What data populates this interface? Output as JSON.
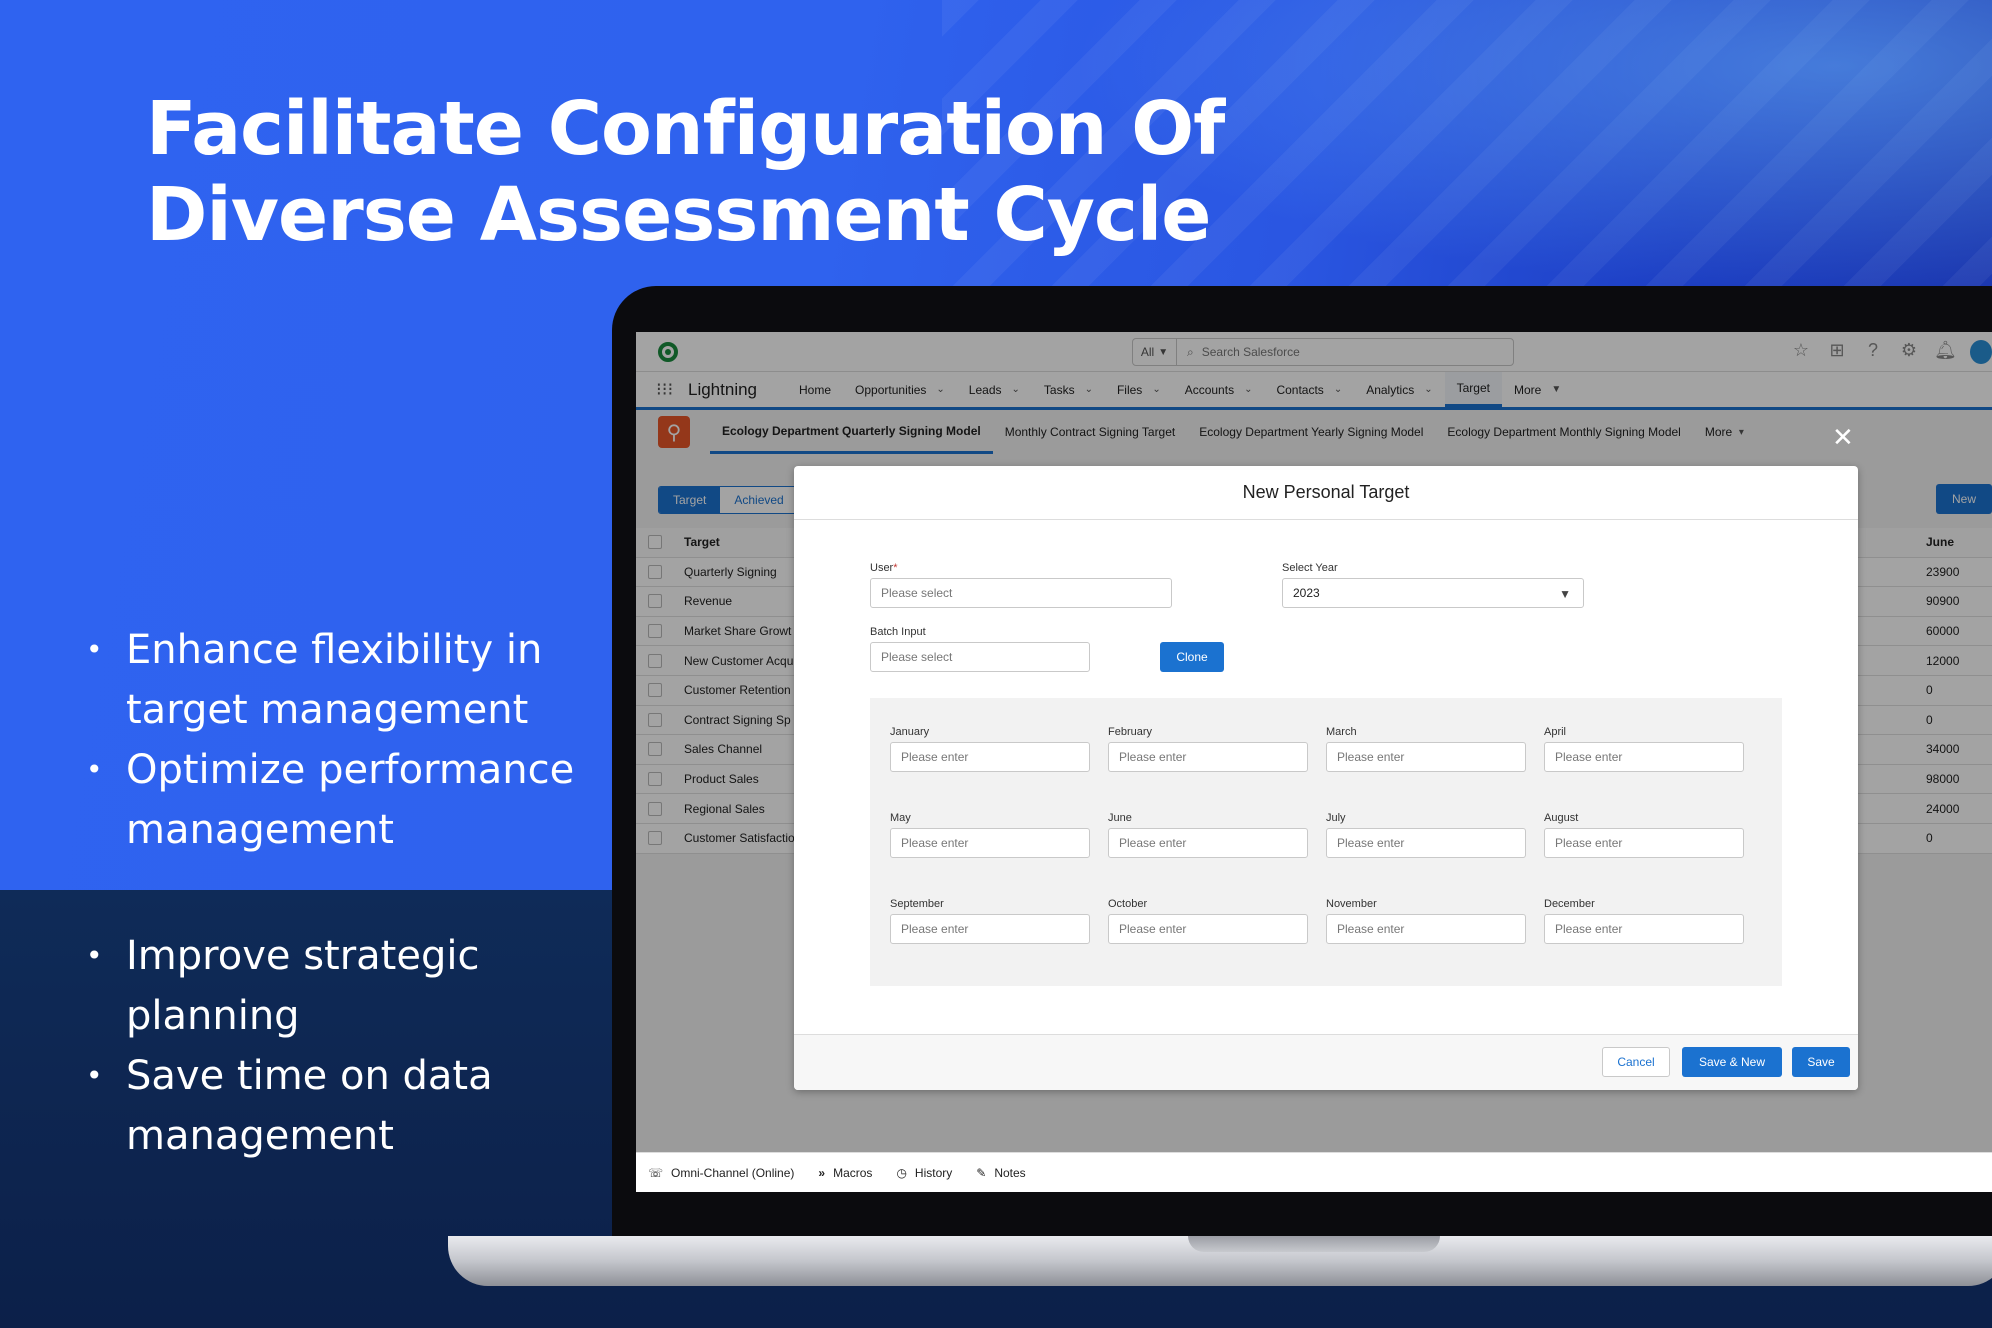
{
  "headline": "Facilitate Configuration Of Diverse Assessment Cycle",
  "bullets_group1": [
    "Enhance flexibility in target management",
    "Optimize performance management"
  ],
  "bullets_group2": [
    "Improve strategic planning",
    "Save time on data management"
  ],
  "sf": {
    "search_scope": "All",
    "search_placeholder": "Search Salesforce",
    "app_name": "Lightning",
    "nav": [
      "Home",
      "Opportunities",
      "Leads",
      "Tasks",
      "Files",
      "Accounts",
      "Contacts",
      "Analytics",
      "Target",
      "More"
    ],
    "active_nav": "Target",
    "sub_tabs": [
      "Ecology Department Quarterly Signing Model",
      "Monthly Contract Signing Target",
      "Ecology Department Yearly Signing Model",
      "Ecology Department Monthly Signing Model",
      "More"
    ],
    "segments": [
      "Target",
      "Achieved"
    ],
    "new_label": "New",
    "table": {
      "col_target": "Target",
      "col_june": "June",
      "rows": [
        {
          "name": "Quarterly Signing",
          "june": "23900"
        },
        {
          "name": "Revenue",
          "june": "90900"
        },
        {
          "name": "Market Share Growt",
          "june": "60000"
        },
        {
          "name": "New Customer Acqu",
          "june": "12000"
        },
        {
          "name": "Customer Retention",
          "june": "0"
        },
        {
          "name": "Contract Signing Sp",
          "june": "0"
        },
        {
          "name": "Sales Channel",
          "june": "34000"
        },
        {
          "name": "Product Sales",
          "june": "98000"
        },
        {
          "name": "Regional Sales",
          "june": "24000"
        },
        {
          "name": "Customer Satisfactio",
          "june": "0"
        }
      ]
    },
    "bottom_bar": [
      "Omni-Channel (Online)",
      "Macros",
      "History",
      "Notes"
    ]
  },
  "modal": {
    "title": "New Personal Target",
    "close_glyph": "✕",
    "user_label": "User",
    "user_placeholder": "Please select",
    "year_label": "Select Year",
    "year_value": "2023",
    "batch_label": "Batch Input",
    "batch_placeholder": "Please select",
    "clone_label": "Clone",
    "month_placeholder": "Please enter",
    "months": [
      "January",
      "February",
      "March",
      "April",
      "May",
      "June",
      "July",
      "August",
      "September",
      "October",
      "November",
      "December"
    ],
    "cancel_label": "Cancel",
    "save_new_label": "Save & New",
    "save_label": "Save"
  }
}
